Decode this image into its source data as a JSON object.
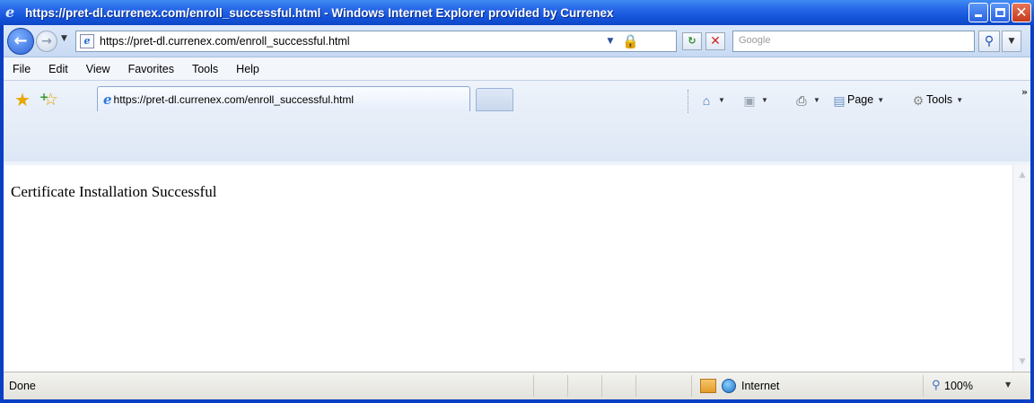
{
  "window": {
    "title": "https://pret-dl.currenex.com/enroll_successful.html - Windows Internet Explorer provided by Currenex"
  },
  "address_bar": {
    "url": "https://pret-dl.currenex.com/enroll_successful.html",
    "search_placeholder": "Google"
  },
  "menu": {
    "items": [
      "File",
      "Edit",
      "View",
      "Favorites",
      "Tools",
      "Help"
    ]
  },
  "tabs": {
    "active_label": "https://pret-dl.currenex.com/enroll_successful.html"
  },
  "command_bar": {
    "page_label": "Page",
    "tools_label": "Tools"
  },
  "content": {
    "message": "Certificate Installation Successful"
  },
  "status_bar": {
    "status": "Done",
    "zone": "Internet",
    "zoom": "100%"
  },
  "icons": {
    "back": "back-arrow-icon",
    "forward": "forward-arrow-icon",
    "lock": "lock-icon",
    "refresh": "refresh-icon",
    "stop": "stop-icon",
    "search": "search-icon",
    "favorites": "favorites-star-icon",
    "home": "home-icon",
    "feeds": "feeds-icon",
    "print": "print-icon"
  },
  "colors": {
    "titlebar": "#1454d9",
    "close_button": "#c43a1a"
  }
}
